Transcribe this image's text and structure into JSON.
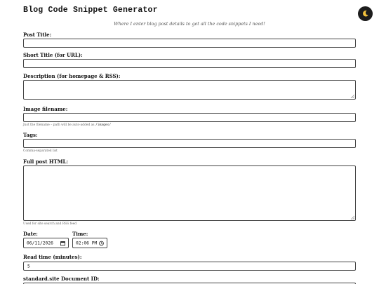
{
  "header": {
    "title": "Blog Code Snippet Generator",
    "subtitle": "Where I enter blog post details to get all the code snippets I need!"
  },
  "theme_toggle": {
    "icon": "moon-icon"
  },
  "form": {
    "post_title": {
      "label": "Post Title:",
      "value": ""
    },
    "short_title": {
      "label": "Short Title (for URL):",
      "value": ""
    },
    "description": {
      "label": "Description (for homepage & RSS):",
      "value": ""
    },
    "image_filename": {
      "label": "Image filename:",
      "value": "",
      "help_prefix": "Just the filename – path will be auto-added as",
      "help_code": "/images/"
    },
    "tags": {
      "label": "Tags:",
      "value": "",
      "help": "Comma-separated list"
    },
    "full_post_html": {
      "label": "Full post HTML:",
      "value": "",
      "help": "Used for site search and RSS feed"
    },
    "date": {
      "label": "Date:",
      "value": "06/11/2026"
    },
    "time": {
      "label": "Time:",
      "value": "02:06 PM"
    },
    "read_time": {
      "label": "Read time (minutes):",
      "value": "5"
    },
    "document_id": {
      "label": "standard.site Document ID:"
    }
  }
}
